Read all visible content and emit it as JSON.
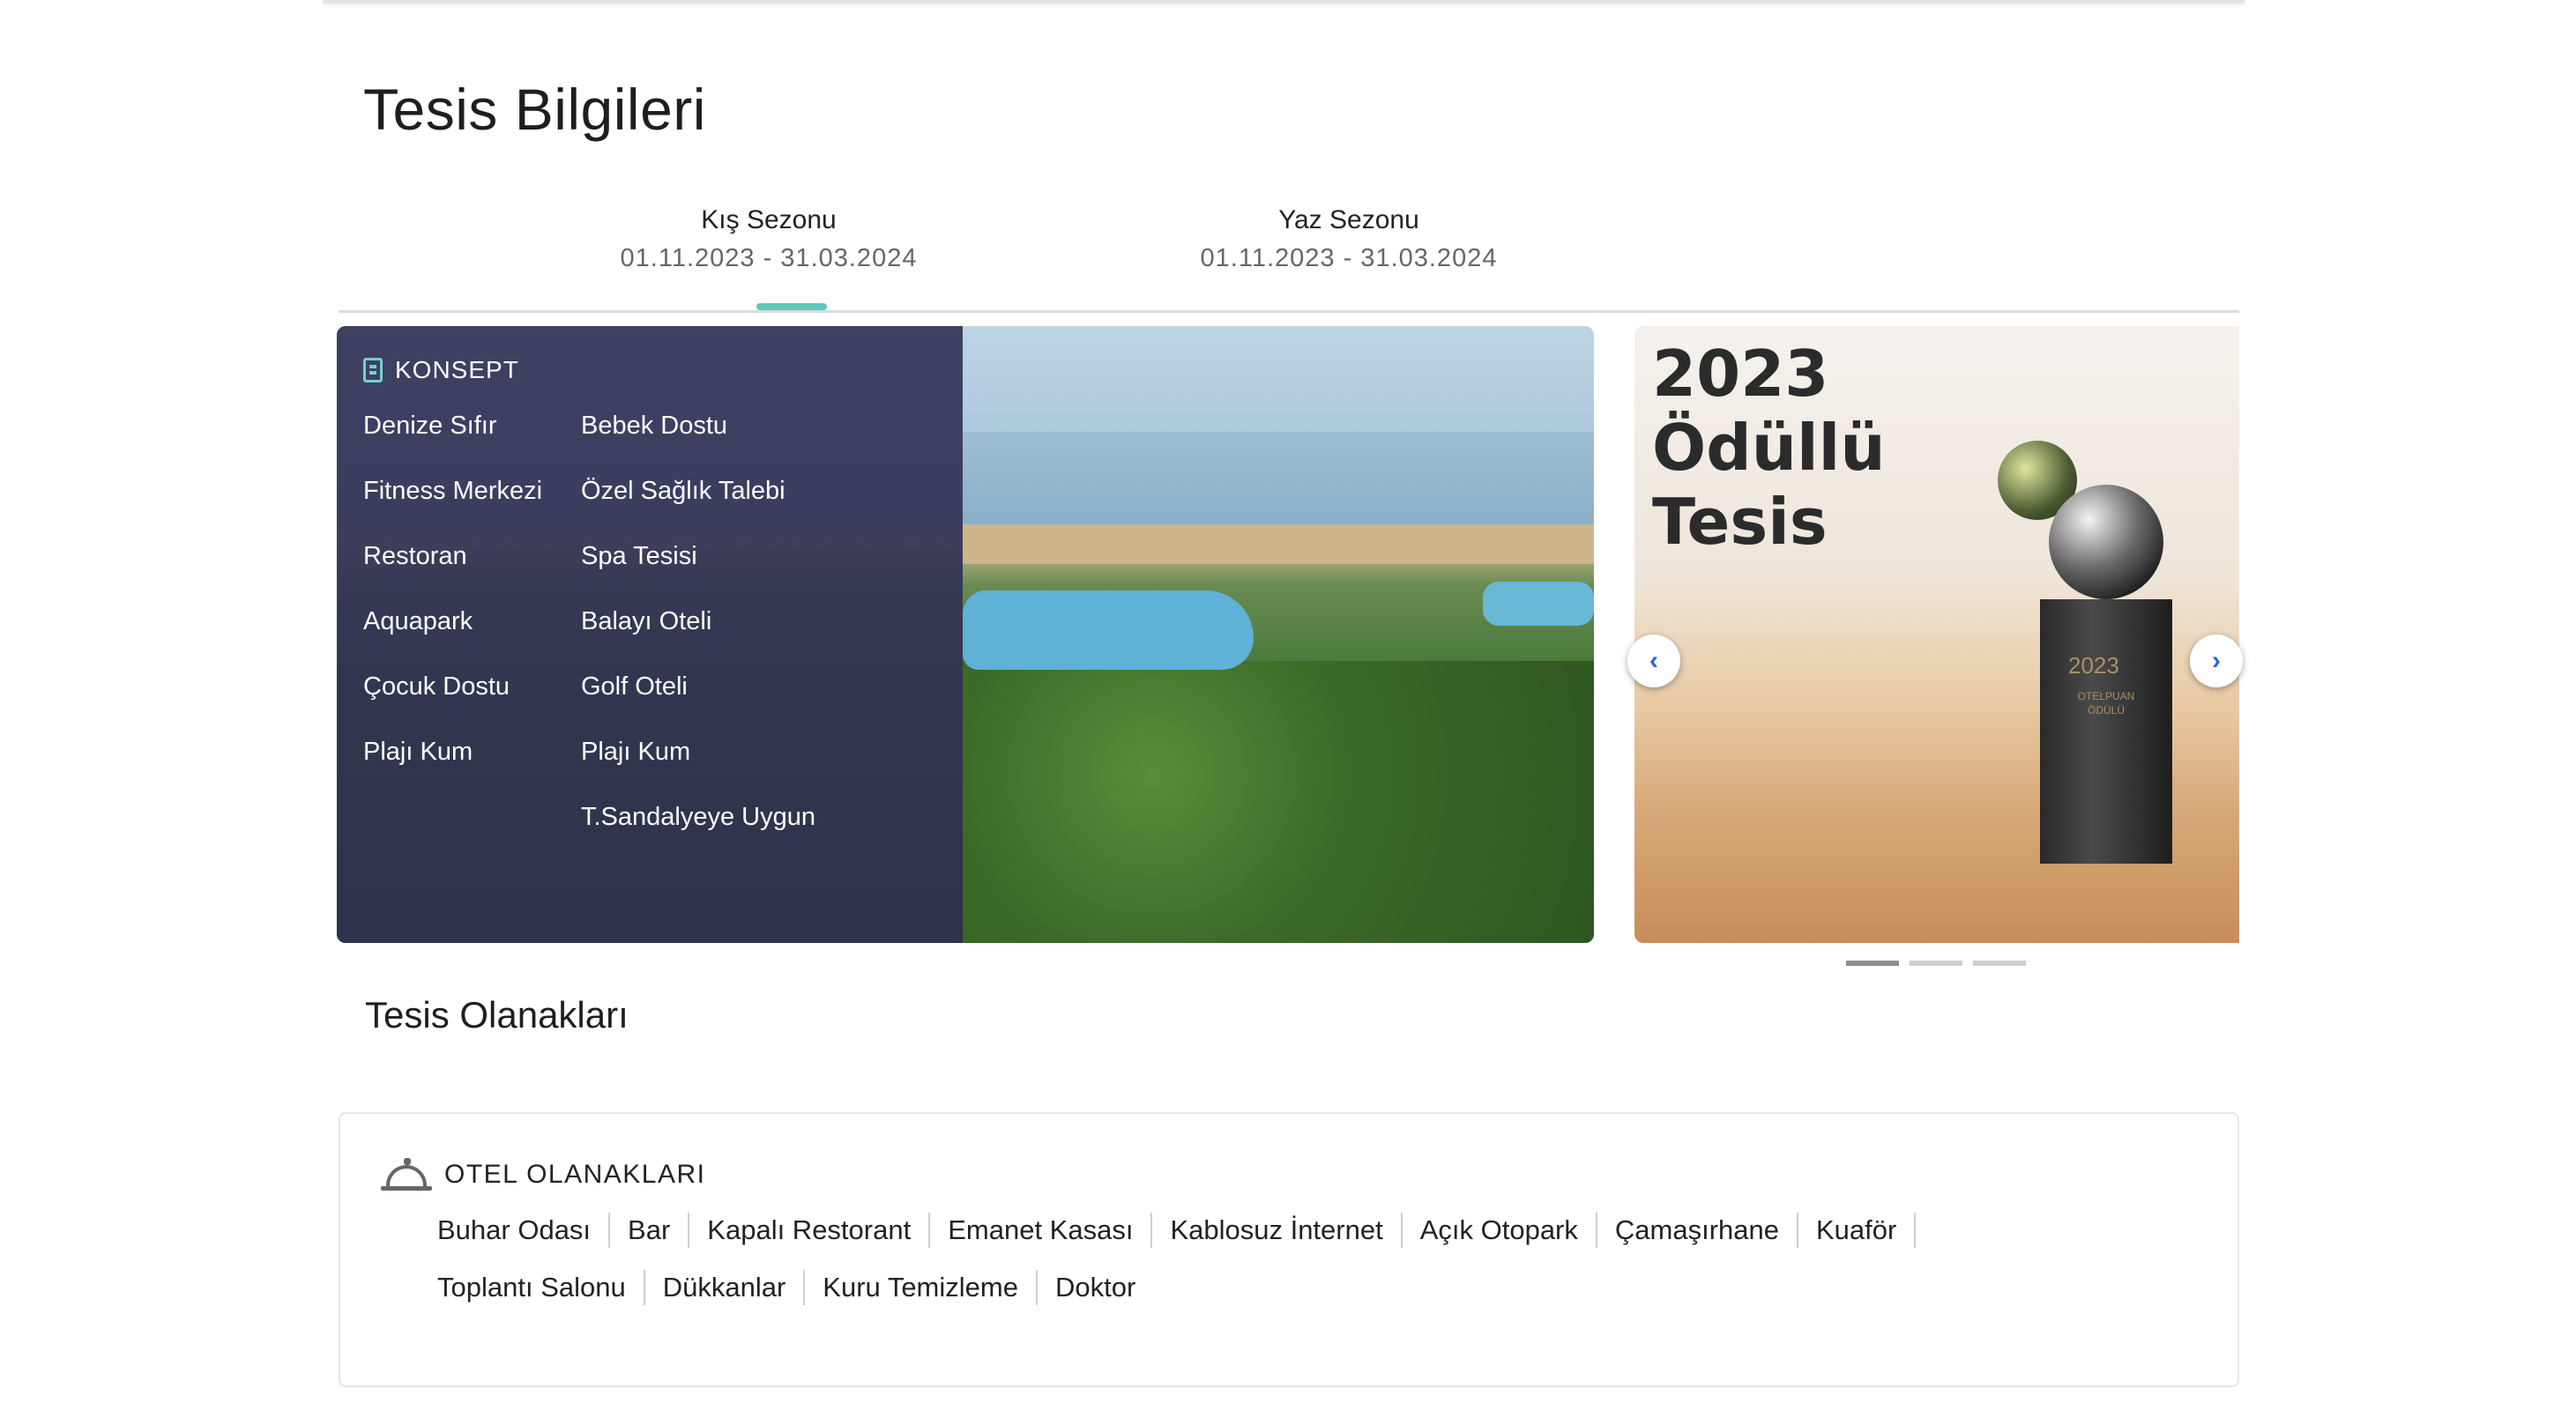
{
  "page": {
    "title": "Tesis Bilgileri"
  },
  "seasons": [
    {
      "name": "Kış Sezonu",
      "dates": "01.11.2023 - 31.03.2024"
    },
    {
      "name": "Yaz Sezonu",
      "dates": "01.11.2023 - 31.03.2024"
    }
  ],
  "concept": {
    "title": "KONSEPT",
    "col1": [
      "Denize Sıfır",
      "Fitness Merkezi",
      "Restoran",
      "Aquapark",
      "Çocuk Dostu",
      "Plajı Kum"
    ],
    "col2": [
      "Bebek Dostu",
      "Özel Sağlık Talebi",
      "Spa Tesisi",
      "Balayı Oteli",
      "Golf Oteli",
      "Plajı Kum",
      "T.Sandalyeye Uygun"
    ]
  },
  "award": {
    "line1": "2023",
    "line2": "Ödüllü",
    "line3": "Tesis",
    "trophy_year": "2023",
    "trophy_text": "OTELPUAN ÖDÜLÜ"
  },
  "carousel": {
    "prev": "‹",
    "next": "›",
    "active_slide": 1,
    "slide_count": 3
  },
  "facilities": {
    "section_title": "Tesis Olanakları",
    "card_title": "OTEL OLANAKLARI",
    "row1": [
      "Buhar Odası",
      "Bar",
      "Kapalı Restorant",
      "Emanet Kasası",
      "Kablosuz İnternet",
      "Açık Otopark",
      "Çamaşırhane",
      "Kuaför"
    ],
    "row2": [
      "Toplantı Salonu",
      "Dükkanlar",
      "Kuru Temizleme",
      "Doktor"
    ]
  },
  "icons": {
    "concept": "building-icon",
    "facilities": "service-bell-icon"
  },
  "colors": {
    "accent": "#5ec9bd",
    "arrow": "#2a63d8",
    "overlay": "#34345a"
  }
}
